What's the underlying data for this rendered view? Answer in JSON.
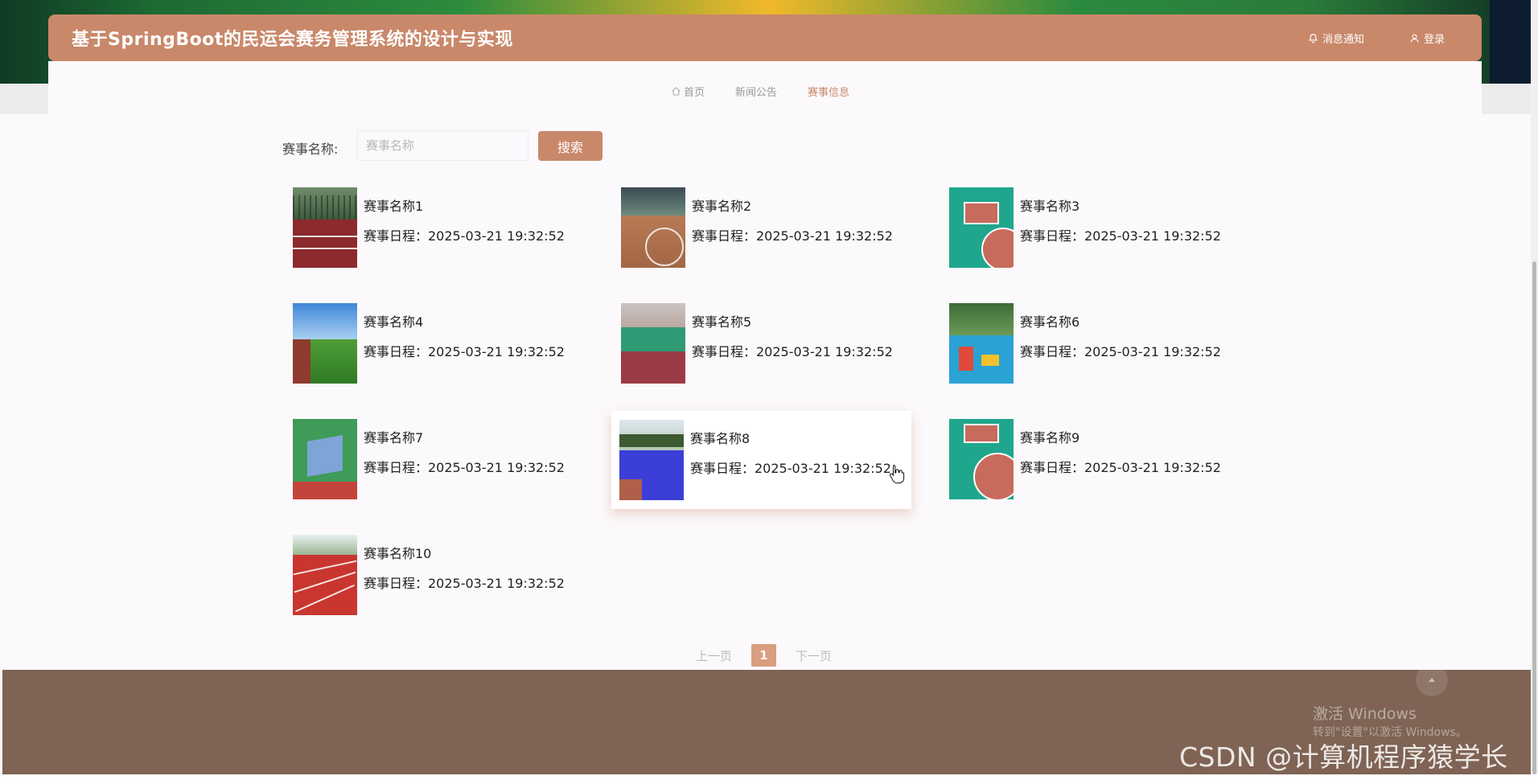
{
  "header": {
    "title": "基于SpringBoot的民运会赛务管理系统的设计与实现",
    "notify_label": "消息通知",
    "login_label": "登录"
  },
  "nav": [
    {
      "label": "首页",
      "icon": "home-icon",
      "active": false
    },
    {
      "label": "新闻公告",
      "active": false
    },
    {
      "label": "赛事信息",
      "active": true
    }
  ],
  "search": {
    "label": "赛事名称:",
    "placeholder": "赛事名称",
    "value": "",
    "button": "搜索"
  },
  "events": [
    {
      "name": "赛事名称1",
      "schedule": "赛事日程：2025-03-21 19:32:52",
      "thumb": "track-with-fence"
    },
    {
      "name": "赛事名称2",
      "schedule": "赛事日程：2025-03-21 19:32:52",
      "thumb": "indoor-court"
    },
    {
      "name": "赛事名称3",
      "schedule": "赛事日程：2025-03-21 19:32:52",
      "thumb": "teal-basketball-court"
    },
    {
      "name": "赛事名称4",
      "schedule": "赛事日程：2025-03-21 19:32:52",
      "thumb": "stadium-grass"
    },
    {
      "name": "赛事名称5",
      "schedule": "赛事日程：2025-03-21 19:32:52",
      "thumb": "campus-court"
    },
    {
      "name": "赛事名称6",
      "schedule": "赛事日程：2025-03-21 19:32:52",
      "thumb": "playground"
    },
    {
      "name": "赛事名称7",
      "schedule": "赛事日程：2025-03-21 19:32:52",
      "thumb": "aerial-field"
    },
    {
      "name": "赛事名称8",
      "schedule": "赛事日程：2025-03-21 19:32:52",
      "thumb": "blue-court"
    },
    {
      "name": "赛事名称9",
      "schedule": "赛事日程：2025-03-21 19:32:52",
      "thumb": "teal-basketball-court"
    },
    {
      "name": "赛事名称10",
      "schedule": "赛事日程：2025-03-21 19:32:52",
      "thumb": "red-running-track"
    }
  ],
  "pagination": {
    "prev": "上一页",
    "current": "1",
    "next": "下一页"
  },
  "footer": {
    "activate_title": "激活 Windows",
    "activate_sub": "转到\"设置\"以激活 Windows。",
    "watermark": "CSDN @计算机程序猿学长"
  },
  "colors": {
    "accent": "#c9886a",
    "footer": "#7f6354",
    "page_active": "#d99d7f"
  }
}
